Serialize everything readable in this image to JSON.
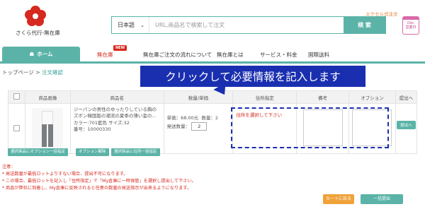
{
  "header": {
    "logo_text": "さくら代行-無在庫",
    "excel_link": "エクセル式注文",
    "search": {
      "language": "日本語",
      "placeholder": "URL,商品名で検索して注文",
      "button": "検 索"
    },
    "calendar_line1": "Dec",
    "calendar_line2": "営業日"
  },
  "nav": {
    "home": "ホーム",
    "new_badge": "NEW",
    "items": [
      "無在庫",
      "無在庫ご注文の流れについて",
      "無在庫とは",
      "サービス・料金",
      "国際送料"
    ]
  },
  "breadcrumb": {
    "top": "トップページ",
    "separator": " > ",
    "current": "注文確認"
  },
  "callout": "クリックして必要情報を記入します",
  "table": {
    "headers": [
      "",
      "商品画像",
      "商品名",
      "数量/単価",
      "住所指定",
      "備考",
      "オプション",
      "提出へ"
    ],
    "row": {
      "name_line1": "ジーパンの男性のゆったりしている胸の",
      "name_line2": "ズボン韓国版の潮流の夏季の薄い金の...",
      "name_line3": "カラー:701藍色 サイズ:32",
      "name_line4": "番号：10000330",
      "unit_price": "単価：68.00元",
      "count": "数量：2",
      "send_qty_label": "発送数量：",
      "send_qty_value": "2",
      "address_prompt": "住所を選択して下さい",
      "submit": "提出へ"
    }
  },
  "batch_buttons": [
    "選択商品にオプション一括指定",
    "オプション解除",
    "選択商品に住所一括指定"
  ],
  "notes": {
    "title": "注意：",
    "items": [
      "* 発送数量が最低ロットよりすない場合、提出不可になります。",
      "* この場合、最低ロットを記入し「住所指定」で「My倉庫に一時保管」を選択し提出して下さい。",
      "* 商品が弊社に到着し、My倉庫に反映されると任意の数量の発送指示が出来るようになります。"
    ]
  },
  "footer": {
    "back_to_cart": "カートに戻る",
    "submit_all": "一括提出"
  }
}
